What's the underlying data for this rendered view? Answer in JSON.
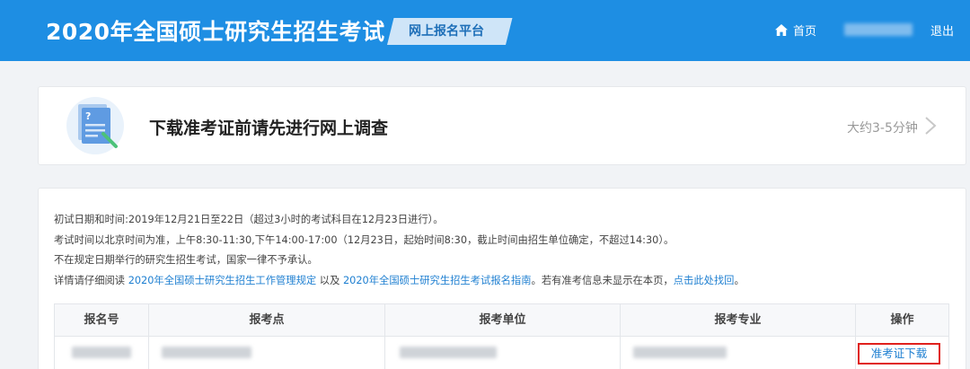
{
  "header": {
    "title": "2020年全国硕士研究生招生考试",
    "platform": "网上报名平台",
    "home": "首页",
    "logout": "退出"
  },
  "survey": {
    "title": "下载准考证前请先进行网上调查",
    "time": "大约3-5分钟"
  },
  "notice": {
    "line1": "初试日期和时间:2019年12月21日至22日（超过3小时的考试科目在12月23日进行）。",
    "line2": "考试时间以北京时间为准，上午8:30-11:30,下午14:00-17:00（12月23日，起始时间8:30，截止时间由招生单位确定，不超过14:30）。",
    "line3": "不在规定日期举行的研究生招生考试，国家一律不予承认。",
    "line4_prefix": "详情请仔细阅读",
    "link_rules": "2020年全国硕士研究生招生工作管理规定",
    "line4_and": "以及",
    "link_guide": "2020年全国硕士研究生招生考试报名指南",
    "line4_mid": "。若有准考信息未显示在本页，",
    "link_recover": "点击此处找回",
    "line4_end": "。"
  },
  "table": {
    "headers": [
      "报名号",
      "报考点",
      "报考单位",
      "报考专业",
      "操作"
    ],
    "download": "准考证下载"
  },
  "colors": {
    "header_bg": "#1e8ee3",
    "link": "#1e7fd1",
    "highlight_border": "#e0201c"
  },
  "icons": [
    "home-icon",
    "chevron-right-icon",
    "survey-document-icon"
  ]
}
